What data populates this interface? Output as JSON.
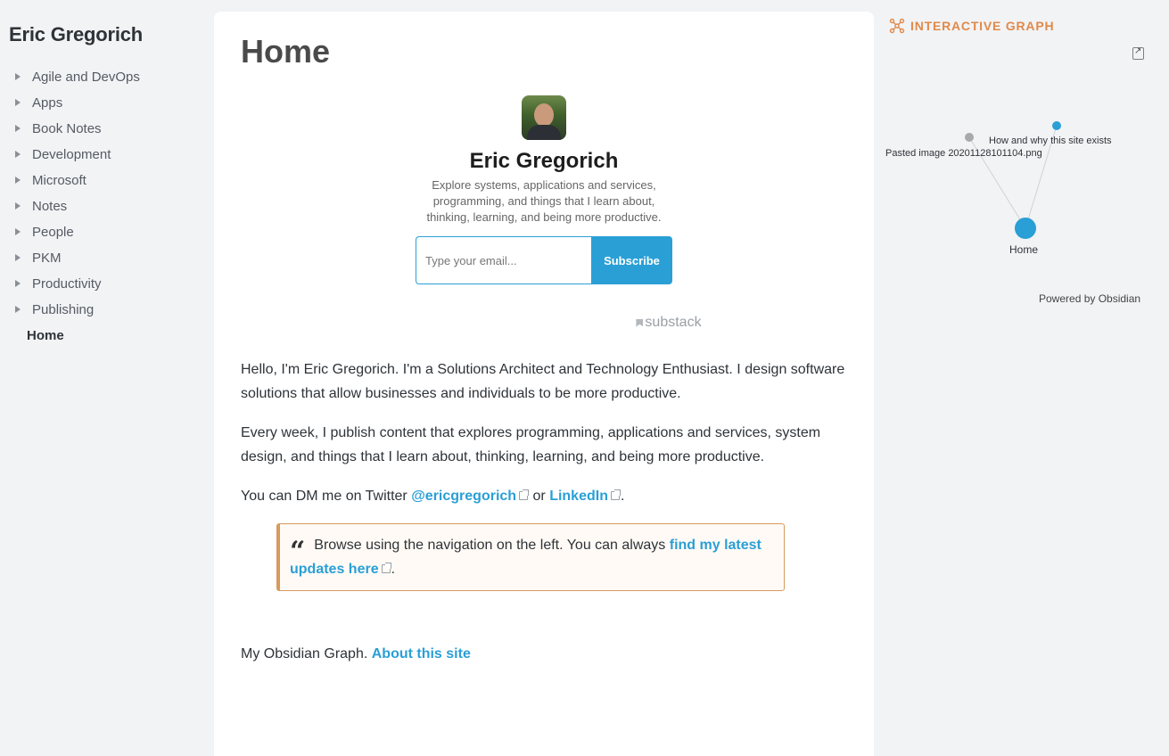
{
  "sidebar": {
    "title": "Eric Gregorich",
    "items": [
      {
        "label": "Agile and DevOps"
      },
      {
        "label": "Apps"
      },
      {
        "label": "Book Notes"
      },
      {
        "label": "Development"
      },
      {
        "label": "Microsoft"
      },
      {
        "label": "Notes"
      },
      {
        "label": "People"
      },
      {
        "label": "PKM"
      },
      {
        "label": "Productivity"
      },
      {
        "label": "Publishing"
      }
    ],
    "active_item": "Home"
  },
  "main": {
    "title": "Home",
    "substack": {
      "name": "Eric Gregorich",
      "description": "Explore systems, applications and services, programming, and things that I learn about, thinking, learning, and being more productive.",
      "email_placeholder": "Type your email...",
      "subscribe_label": "Subscribe",
      "brand": "substack"
    },
    "intro": "Hello, I'm Eric Gregorich. I'm a Solutions Architect and Technology Enthusiast. I design software solutions that allow businesses and individuals to be more productive.",
    "weekly": "Every week, I publish content that explores programming, applications and services, system design, and things that I learn about, thinking, learning, and being more productive.",
    "dm_prefix": "You can DM me on Twitter ",
    "twitter_link": "@ericgregorich",
    "dm_or": " or ",
    "linkedin_link": "LinkedIn",
    "dm_suffix": ".",
    "callout_text": "Browse using the navigation on the left. You can always ",
    "callout_link": "find my latest updates here",
    "callout_suffix": ".",
    "footer_text": "My Obsidian Graph. ",
    "footer_link": "About this site"
  },
  "graph": {
    "header": "INTERACTIVE GRAPH",
    "nodes": [
      {
        "label": "Pasted image 20201128101104.png",
        "color": "#a9a9a9"
      },
      {
        "label": "How and why this site exists",
        "color": "#2a9fd6"
      },
      {
        "label": "Home",
        "color": "#2a9fd6"
      }
    ],
    "powered_by": "Powered by Obsidian",
    "accent_color": "#e08a4a"
  }
}
